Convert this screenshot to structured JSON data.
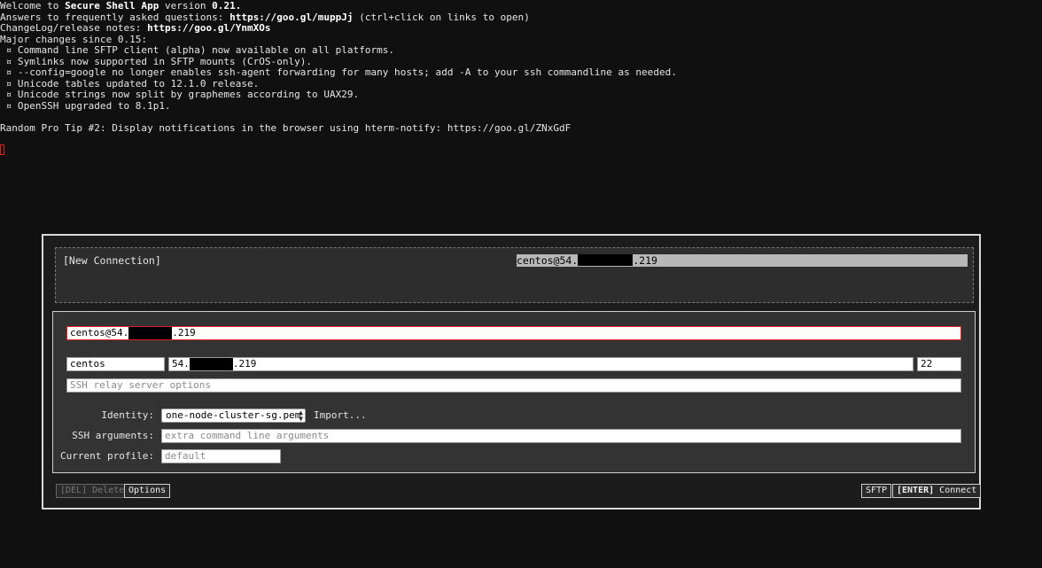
{
  "terminal": {
    "welcome_prefix": "Welcome to ",
    "app_name": "Secure Shell App",
    "version_prefix": " version ",
    "version": "0.21.",
    "faq_prefix": "Answers to frequently asked questions: ",
    "faq_url": "https://goo.gl/muppJj",
    "faq_suffix": " (ctrl+click on links to open)",
    "changelog_prefix": "ChangeLog/release notes: ",
    "changelog_url": "https://goo.gl/YnmXOs",
    "major_changes": "Major changes since 0.15:",
    "changes": [
      " ¤ Command line SFTP client (alpha) now available on all platforms.",
      " ¤ Symlinks now supported in SFTP mounts (CrOS-only).",
      " ¤ --config=google no longer enables ssh-agent forwarding for many hosts; add -A to your ssh commandline as needed.",
      " ¤ Unicode tables updated to 12.1.0 release.",
      " ¤ Unicode strings now split by graphemes according to UAX29.",
      " ¤ OpenSSH upgraded to 8.1p1."
    ],
    "pro_tip": "Random Pro Tip #2: Display notifications in the browser using hterm-notify: https://goo.gl/ZNxGdF"
  },
  "dialog": {
    "profiles": {
      "new_connection": "[New Connection]",
      "selected_prefix": "centos@54.",
      "selected_suffix": ".219"
    },
    "form": {
      "destination_prefix": "centos@54.",
      "destination_suffix": ".219",
      "username": "centos",
      "hostname_prefix": "54.",
      "hostname_suffix": ".219",
      "port": "22",
      "relay_placeholder": "SSH relay server options",
      "identity_label": "Identity:",
      "identity_value": "one-node-cluster-sg.pem",
      "import_label": "Import...",
      "ssh_args_label": "SSH arguments:",
      "ssh_args_placeholder": "extra command line arguments",
      "profile_label": "Current profile:",
      "profile_placeholder": "default"
    },
    "buttons": {
      "delete_key": "[DEL]",
      "delete_label": " Delete",
      "options": "Options",
      "sftp": "SFTP",
      "connect_key": "[ENTER]",
      "connect_label": " Connect"
    }
  }
}
